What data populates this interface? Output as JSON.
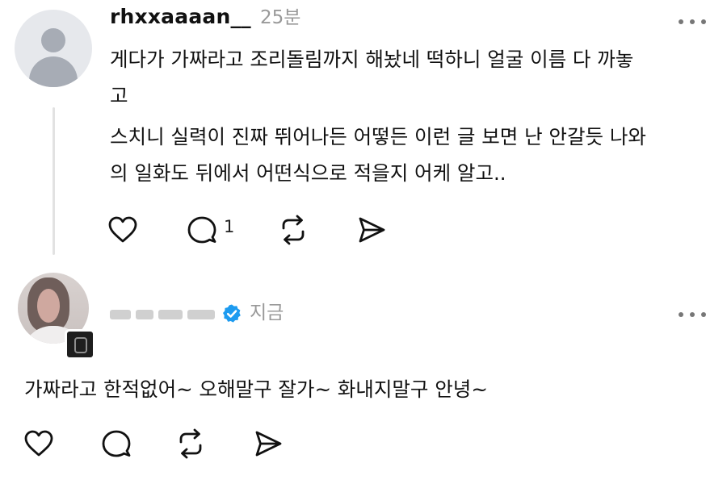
{
  "post": {
    "username": "rhxxaaaan__",
    "time": "25분",
    "paragraphs": [
      "게다가 가짜라고 조리돌림까지 해놨네 떡하니 얼굴 이름 다 까놓\n고",
      "스치니 실력이 진짜 뛰어나든 어떻든 이런 글 보면 난 안갈듯 나와\n의 일화도 뒤에서 어떤식으로 적을지 어케 알고.."
    ],
    "actions": {
      "like_icon": "heart-icon",
      "comment_icon": "comment-icon",
      "comment_count": "1",
      "repost_icon": "repost-icon",
      "share_icon": "share-icon"
    }
  },
  "reply": {
    "time": "지금",
    "text": "가짜라고 한적없어~ 오해말구 잘가~ 화내지말구 안녕~",
    "verified_color": "#1d9bf0",
    "actions": {
      "like_icon": "heart-icon",
      "comment_icon": "comment-icon",
      "repost_icon": "repost-icon",
      "share_icon": "share-icon"
    }
  }
}
